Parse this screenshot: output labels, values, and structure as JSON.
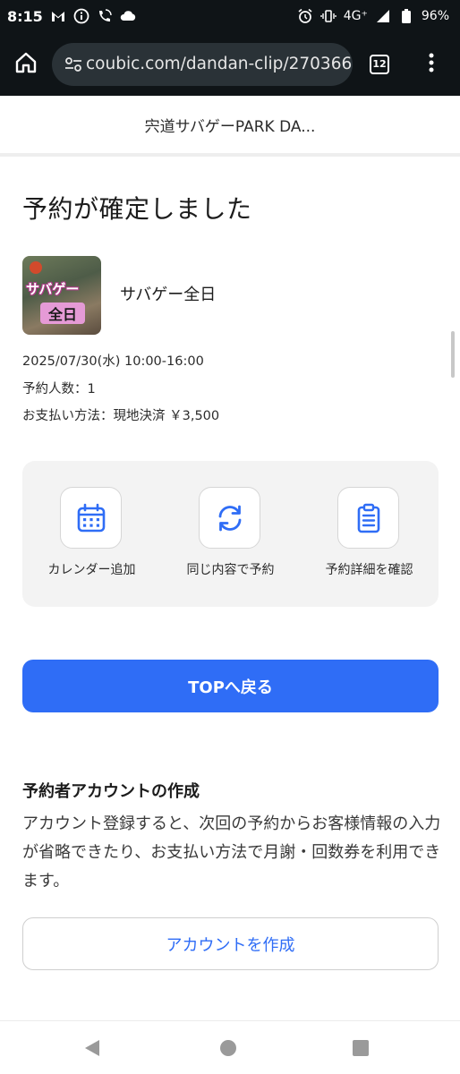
{
  "status_bar": {
    "time": "8:15",
    "network": "4G⁺",
    "battery": "96%",
    "left_icons": [
      "gmail-icon",
      "info-icon",
      "wifi-calling-icon",
      "cloud-icon"
    ],
    "right_icons": [
      "alarm-icon",
      "vibrate-icon",
      "signal-icon",
      "battery-icon"
    ]
  },
  "browser": {
    "url": "coubic.com/dandan-clip/270366",
    "tab_count": "12"
  },
  "page": {
    "header_title": "宍道サバゲーPARK DA...",
    "confirm_title": "予約が確定しました",
    "thumbnail": {
      "line1": "サバゲー",
      "line2": "全日"
    },
    "menu_name": "サバゲー全日",
    "datetime": "2025/07/30(水) 10:00-16:00",
    "people": "予約人数：1",
    "payment": "お支払い方法：現地決済 ￥3,500",
    "actions": [
      {
        "label": "カレンダー追加",
        "icon": "calendar-icon"
      },
      {
        "label": "同じ内容で予約",
        "icon": "sync-icon"
      },
      {
        "label": "予約詳細を確認",
        "icon": "clipboard-icon"
      }
    ],
    "top_button": "TOPへ戻る",
    "account": {
      "title": "予約者アカウントの作成",
      "description": "アカウント登録すると、次回の予約からお客様情報の入力が省略できたり、お支払い方法で月謝・回数券を利用できます。",
      "button": "アカウントを作成"
    }
  },
  "colors": {
    "accent": "#2f6df6",
    "status_bar_bg": "#0f1417",
    "panel_bg": "#f3f3f3"
  }
}
